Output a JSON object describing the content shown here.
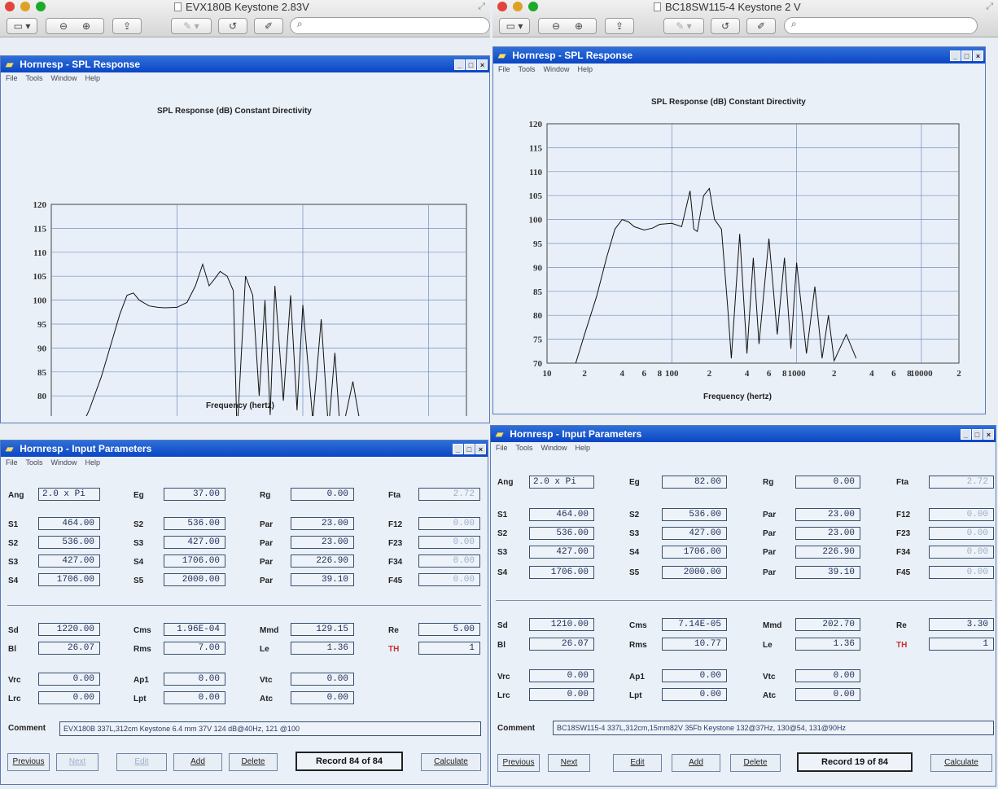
{
  "left_preview": {
    "title": "EVX180B Keystone 2.83V"
  },
  "right_preview": {
    "title": "BC18SW115-4 Keystone 2 V"
  },
  "toolbar": {
    "search_placeholder": ""
  },
  "spl_windows": {
    "title": "Hornresp - SPL Response",
    "menu": [
      "File",
      "Tools",
      "Window",
      "Help"
    ],
    "chart_title": "SPL Response (dB)   Constant Directivity",
    "xlabel": "Frequency (hertz)",
    "x_ticks": [
      "10",
      "2",
      "4",
      "6",
      "8",
      "100",
      "2",
      "4",
      "6",
      "8",
      "1000",
      "2",
      "4",
      "6",
      "8",
      "10000",
      "2"
    ],
    "y_ticks": [
      "120",
      "115",
      "110",
      "105",
      "100",
      "95",
      "90",
      "85",
      "80",
      "75",
      "70"
    ]
  },
  "chart_data": [
    {
      "type": "line",
      "title": "SPL Response (dB)   Constant Directivity",
      "xlabel": "Frequency (hertz)",
      "ylabel": "",
      "x_scale": "log",
      "xlim": [
        10,
        20000
      ],
      "ylim": [
        70,
        120
      ],
      "grid": true,
      "series": [
        {
          "x": [
            15,
            20,
            25,
            30,
            35,
            40,
            45,
            50,
            60,
            70,
            80,
            100,
            120,
            140,
            160,
            180,
            200,
            220,
            250,
            280,
            300,
            350,
            400,
            450,
            500,
            550,
            600,
            700,
            800,
            900,
            1000,
            1200,
            1400,
            1600,
            1800,
            2000,
            2500,
            3000
          ],
          "y": [
            70,
            77,
            84,
            91,
            97,
            101,
            101.5,
            100,
            98.8,
            98.5,
            98.4,
            98.5,
            99.5,
            103,
            107.5,
            103,
            104.5,
            106,
            105,
            102,
            72,
            105,
            101,
            80,
            100,
            76,
            103,
            79,
            101,
            77,
            99,
            75,
            96,
            73,
            89,
            71,
            83,
            71
          ]
        }
      ]
    },
    {
      "type": "line",
      "title": "SPL Response (dB)   Constant Directivity",
      "xlabel": "Frequency (hertz)",
      "ylabel": "",
      "x_scale": "log",
      "xlim": [
        10,
        20000
      ],
      "ylim": [
        70,
        120
      ],
      "grid": true,
      "series": [
        {
          "x": [
            17,
            20,
            25,
            30,
            35,
            40,
            45,
            50,
            60,
            70,
            80,
            100,
            120,
            140,
            150,
            160,
            180,
            200,
            220,
            250,
            280,
            300,
            350,
            400,
            450,
            500,
            600,
            700,
            800,
            900,
            1000,
            1200,
            1400,
            1600,
            1800,
            2000,
            2500,
            3000
          ],
          "y": [
            70,
            76,
            84,
            92,
            98,
            100,
            99.5,
            98.5,
            97.8,
            98.2,
            99,
            99.2,
            98.5,
            106,
            98,
            97.5,
            105,
            106.5,
            100,
            98,
            82,
            71,
            97,
            72,
            92,
            74,
            96,
            76,
            92,
            73,
            91,
            72,
            86,
            71,
            80,
            70.5,
            76,
            71
          ]
        }
      ]
    }
  ],
  "input_windows": {
    "title": "Hornresp - Input Parameters",
    "menu": [
      "File",
      "Tools",
      "Window",
      "Help"
    ],
    "labels": {
      "ang": "Ang",
      "eg": "Eg",
      "rg": "Rg",
      "fta": "Fta",
      "s1": "S1",
      "s2": "S2",
      "s3": "S3",
      "s4": "S4",
      "s5": "S5",
      "par": "Par",
      "f12": "F12",
      "f23": "F23",
      "f34": "F34",
      "f45": "F45",
      "sd": "Sd",
      "cms": "Cms",
      "mmd": "Mmd",
      "re": "Re",
      "bl": "Bl",
      "rms": "Rms",
      "le": "Le",
      "th": "TH",
      "vrc": "Vrc",
      "ap1": "Ap1",
      "vtc": "Vtc",
      "lrc": "Lrc",
      "lpt": "Lpt",
      "atc": "Atc",
      "comment": "Comment"
    },
    "buttons": {
      "previous": "Previous",
      "next": "Next",
      "edit": "Edit",
      "add": "Add",
      "delete": "Delete",
      "calculate": "Calculate"
    }
  },
  "left_params": {
    "ang": "2.0 x Pi",
    "eg": "37.00",
    "rg": "0.00",
    "fta": "2.72",
    "s1": "464.00",
    "s2": "536.00",
    "s3": "427.00",
    "s4": "1706.00",
    "s5": "2000.00",
    "par12": "23.00",
    "par23": "23.00",
    "par34": "226.90",
    "par45": "39.10",
    "f12": "0.00",
    "f23": "0.00",
    "f34": "0.00",
    "f45": "0.00",
    "sd": "1220.00",
    "cms": "1.96E-04",
    "mmd": "129.15",
    "re": "5.00",
    "bl": "26.07",
    "rms": "7.00",
    "le": "1.36",
    "th": "1",
    "vrc": "0.00",
    "ap1": "0.00",
    "vtc": "0.00",
    "lrc": "0.00",
    "lpt": "0.00",
    "atc": "0.00",
    "comment": "EVX180B 337L,312cm  Keystone 6.4 mm 37V 124 dB@40Hz, 121 @100",
    "record": "Record 84 of 84"
  },
  "right_params": {
    "ang": "2.0 x Pi",
    "eg": "82.00",
    "rg": "0.00",
    "fta": "2.72",
    "s1": "464.00",
    "s2": "536.00",
    "s3": "427.00",
    "s4": "1706.00",
    "s5": "2000.00",
    "par12": "23.00",
    "par23": "23.00",
    "par34": "226.90",
    "par45": "39.10",
    "f12": "0.00",
    "f23": "0.00",
    "f34": "0.00",
    "f45": "0.00",
    "sd": "1210.00",
    "cms": "7.14E-05",
    "mmd": "202.70",
    "re": "3.30",
    "bl": "26.07",
    "rms": "10.77",
    "le": "1.36",
    "th": "1",
    "vrc": "0.00",
    "ap1": "0.00",
    "vtc": "0.00",
    "lrc": "0.00",
    "lpt": "0.00",
    "atc": "0.00",
    "comment": "BC18SW115-4  337L,312cm,15mm82V 35Fb Keystone 132@37Hz, 130@54, 131@90Hz",
    "record": "Record 19 of 84"
  }
}
